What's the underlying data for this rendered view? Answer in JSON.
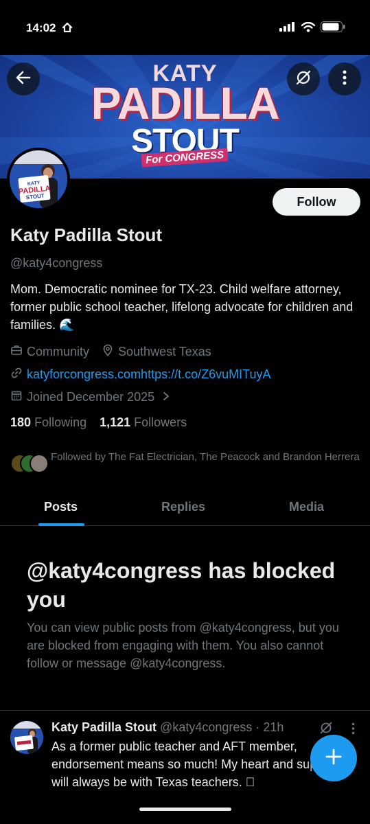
{
  "status_bar": {
    "time": "14:02"
  },
  "banner": {
    "logo_line1": "KATY",
    "logo_line2": "PADILLA",
    "logo_line3": "STOUT",
    "logo_line4": "For CONGRESS"
  },
  "avatar": {
    "sign_line1": "KATY",
    "sign_line2": "PADILLA",
    "sign_line3": "STOUT"
  },
  "profile": {
    "follow_label": "Follow",
    "name": "Katy Padilla Stout",
    "handle": "@katy4congress",
    "bio": "Mom. Democratic nominee for TX-23. Child welfare attorney, former public school teacher, lifelong advocate for children and families. 🌊",
    "category": "Community",
    "location": "Southwest Texas",
    "website": "katyforcongress.comhttps://t.co/Z6vuMITuyA",
    "joined": "Joined December 2025",
    "following_count": "180",
    "following_label": "Following",
    "followers_count": "1,121",
    "followers_label": "Followers",
    "followed_by": "Followed by The Fat Electrician, The Peacock and Brandon Herrera"
  },
  "tabs": [
    {
      "label": "Posts",
      "active": true
    },
    {
      "label": "Replies",
      "active": false
    },
    {
      "label": "Media",
      "active": false
    }
  ],
  "blocked": {
    "title": "@katy4congress has blocked you",
    "message": "You can view public posts from @katy4congress, but you are blocked from engaging with them. You also cannot follow or message @katy4congress."
  },
  "post": {
    "author": "Katy Padilla Stout",
    "meta": "@katy4congress · 21h",
    "text": "As a former public teacher and AFT member, endorsement means so much! My heart and support will always be with Texas teachers. 🏽"
  },
  "colors": {
    "accent": "#1d9bf0",
    "background": "#000000",
    "text_primary": "#e7e9ea",
    "text_secondary": "#71767b",
    "banner_blue": "#1d45a3"
  },
  "icons": [
    "back-arrow-icon",
    "grok-icon",
    "more-vertical-icon",
    "briefcase-icon",
    "location-pin-icon",
    "link-icon",
    "calendar-icon",
    "chevron-right-icon",
    "plus-icon"
  ]
}
